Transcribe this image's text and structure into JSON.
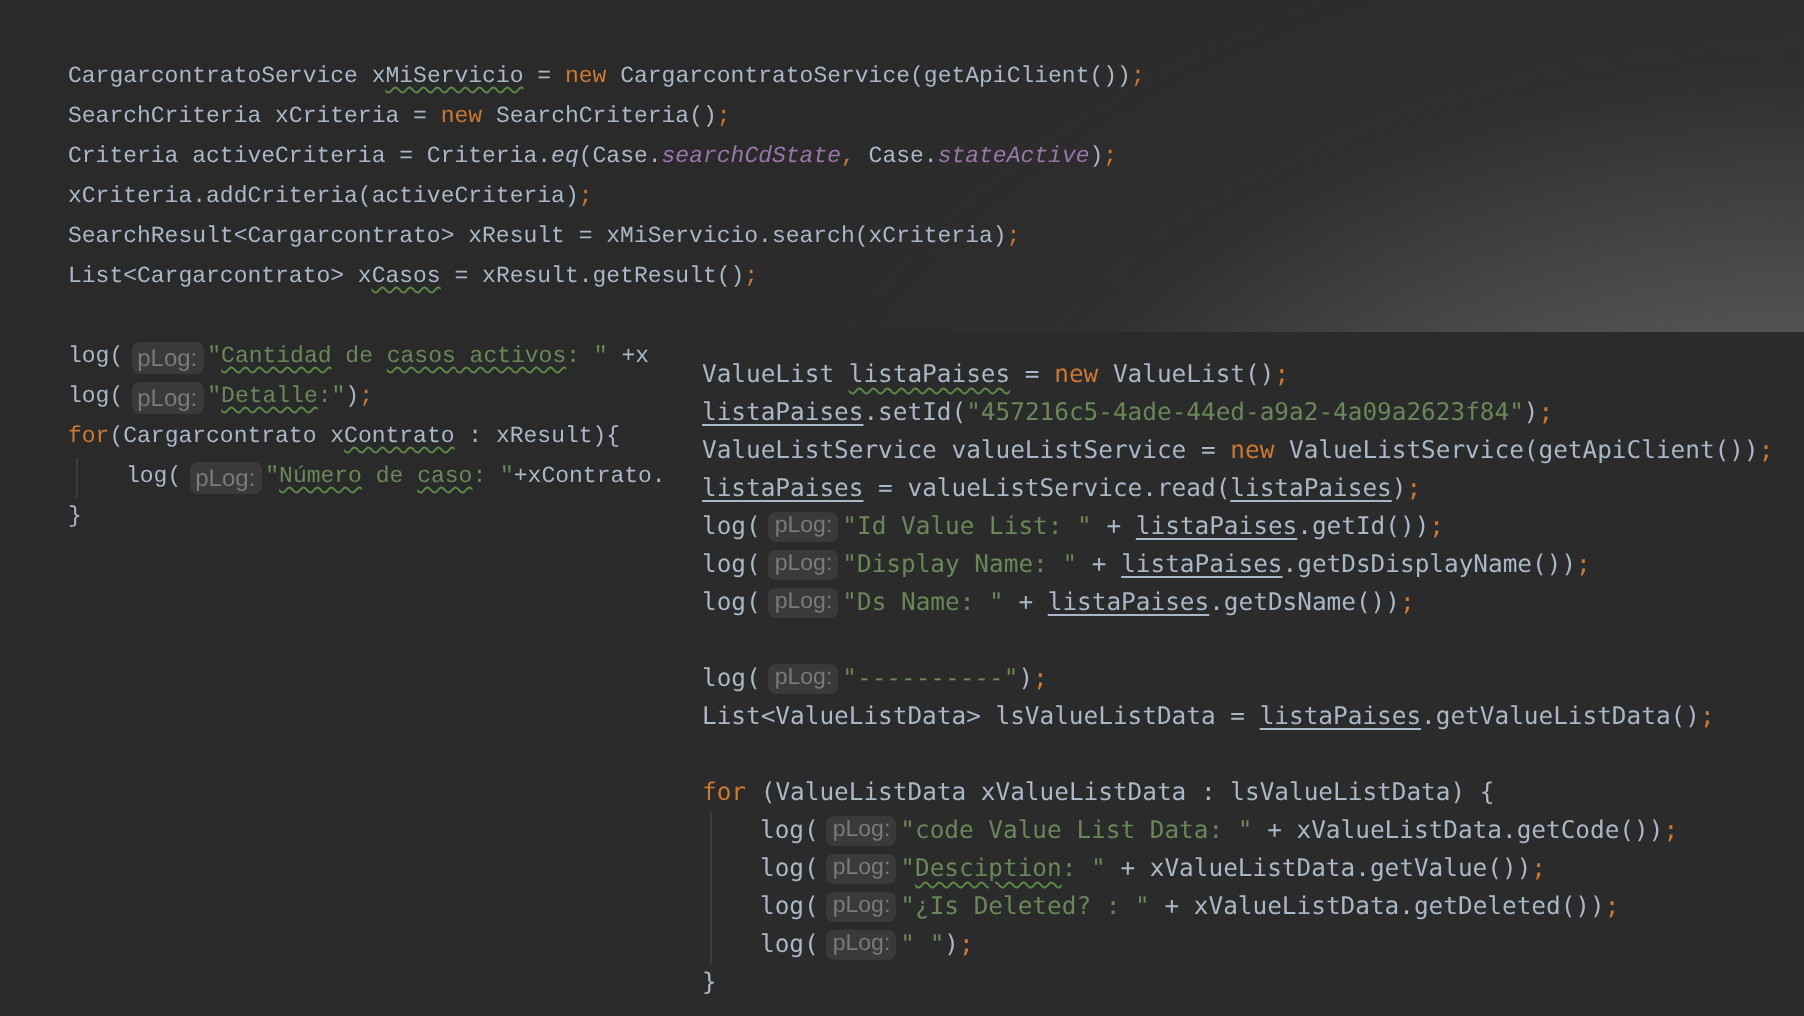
{
  "editors": [
    {
      "lines": [
        {
          "kind": "code",
          "tokens": [
            {
              "text": "CargarcontratoService x",
              "kind": "plain"
            },
            {
              "text": "MiServicio",
              "kind": "plain",
              "wavy": true
            },
            {
              "text": " = ",
              "kind": "plain"
            },
            {
              "text": "new",
              "kind": "keyword"
            },
            {
              "text": " CargarcontratoService(getApiClient())",
              "kind": "plain"
            },
            {
              "text": ";",
              "kind": "keyword"
            }
          ]
        },
        {
          "kind": "code",
          "tokens": [
            {
              "text": "SearchCriteria xCriteria = ",
              "kind": "plain"
            },
            {
              "text": "new",
              "kind": "keyword"
            },
            {
              "text": " SearchCriteria()",
              "kind": "plain"
            },
            {
              "text": ";",
              "kind": "keyword"
            }
          ]
        },
        {
          "kind": "code",
          "tokens": [
            {
              "text": "Criteria activeCriteria = Criteria.",
              "kind": "plain"
            },
            {
              "text": "eq",
              "kind": "method"
            },
            {
              "text": "(Case.",
              "kind": "plain"
            },
            {
              "text": "searchCdState",
              "kind": "field"
            },
            {
              "text": ",",
              "kind": "keyword"
            },
            {
              "text": " Case.",
              "kind": "plain"
            },
            {
              "text": "stateActive",
              "kind": "field"
            },
            {
              "text": ")",
              "kind": "plain"
            },
            {
              "text": ";",
              "kind": "keyword"
            }
          ]
        },
        {
          "kind": "code",
          "tokens": [
            {
              "text": "xCriteria.addCriteria(activeCriteria)",
              "kind": "plain"
            },
            {
              "text": ";",
              "kind": "keyword"
            }
          ]
        },
        {
          "kind": "code",
          "tokens": [
            {
              "text": "SearchResult<Cargarcontrato> xResult = xMiServicio.search(xCriteria)",
              "kind": "plain"
            },
            {
              "text": ";",
              "kind": "keyword"
            }
          ]
        },
        {
          "kind": "code",
          "tokens": [
            {
              "text": "List<Cargarcontrato> x",
              "kind": "plain"
            },
            {
              "text": "Casos",
              "kind": "plain",
              "wavy": true
            },
            {
              "text": " = xResult.getResult()",
              "kind": "plain"
            },
            {
              "text": ";",
              "kind": "keyword"
            }
          ]
        },
        {
          "kind": "blank"
        },
        {
          "kind": "code",
          "tokens": [
            {
              "text": "log(",
              "kind": "plain"
            },
            {
              "text": "pLog:",
              "kind": "hint"
            },
            {
              "text": "\"",
              "kind": "string"
            },
            {
              "text": "Cantidad",
              "kind": "string",
              "wavy": true
            },
            {
              "text": " de ",
              "kind": "string"
            },
            {
              "text": "casos",
              "kind": "string",
              "wavy": true
            },
            {
              "text": " activos",
              "kind": "string",
              "wavy": true
            },
            {
              "text": ": \"",
              "kind": "string"
            },
            {
              "text": " +x",
              "kind": "plain"
            }
          ]
        },
        {
          "kind": "code",
          "tokens": [
            {
              "text": "log(",
              "kind": "plain"
            },
            {
              "text": "pLog:",
              "kind": "hint"
            },
            {
              "text": "\"",
              "kind": "string"
            },
            {
              "text": "Detalle",
              "kind": "string",
              "wavy": true
            },
            {
              "text": ":\"",
              "kind": "string"
            },
            {
              "text": ")",
              "kind": "plain"
            },
            {
              "text": ";",
              "kind": "keyword"
            }
          ]
        },
        {
          "kind": "code",
          "tokens": [
            {
              "text": "for",
              "kind": "keyword"
            },
            {
              "text": "(Cargarcontrato x",
              "kind": "plain"
            },
            {
              "text": "Contrato",
              "kind": "plain",
              "wavy": true
            },
            {
              "text": " : xResult){",
              "kind": "plain"
            }
          ],
          "children": [
            {
              "kind": "code",
              "tokens": [
                {
                  "text": "log(",
                  "kind": "plain"
                },
                {
                  "text": "pLog:",
                  "kind": "hint"
                },
                {
                  "text": "\"",
                  "kind": "string"
                },
                {
                  "text": "Número",
                  "kind": "string",
                  "wavy": true
                },
                {
                  "text": " de ",
                  "kind": "string"
                },
                {
                  "text": "caso",
                  "kind": "string",
                  "wavy": true
                },
                {
                  "text": ": \"",
                  "kind": "string"
                },
                {
                  "text": "+xContrato.",
                  "kind": "plain"
                }
              ]
            }
          ]
        },
        {
          "kind": "code",
          "tokens": [
            {
              "text": "}",
              "kind": "plain"
            }
          ]
        }
      ]
    },
    {
      "lines": [
        {
          "kind": "code",
          "tokens": [
            {
              "text": "ValueList ",
              "kind": "plain"
            },
            {
              "text": "listaPaises",
              "kind": "plain",
              "wavy": true
            },
            {
              "text": " = ",
              "kind": "plain"
            },
            {
              "text": "new",
              "kind": "keyword"
            },
            {
              "text": " ValueList()",
              "kind": "plain"
            },
            {
              "text": ";",
              "kind": "keyword"
            }
          ]
        },
        {
          "kind": "code",
          "tokens": [
            {
              "text": "listaPaises",
              "kind": "plain",
              "underline": true
            },
            {
              "text": ".setId(",
              "kind": "plain"
            },
            {
              "text": "\"457216c5-4ade-44ed-a9a2-4a09a2623f84\"",
              "kind": "string"
            },
            {
              "text": ")",
              "kind": "plain"
            },
            {
              "text": ";",
              "kind": "keyword"
            }
          ]
        },
        {
          "kind": "code",
          "tokens": [
            {
              "text": "ValueListService valueListService = ",
              "kind": "plain"
            },
            {
              "text": "new",
              "kind": "keyword"
            },
            {
              "text": " ValueListService(getApiClient())",
              "kind": "plain"
            },
            {
              "text": ";",
              "kind": "keyword"
            }
          ]
        },
        {
          "kind": "code",
          "tokens": [
            {
              "text": "listaPaises",
              "kind": "plain",
              "underline": true
            },
            {
              "text": " = valueListService.read(",
              "kind": "plain"
            },
            {
              "text": "listaPaises",
              "kind": "plain",
              "underline": true
            },
            {
              "text": ")",
              "kind": "plain"
            },
            {
              "text": ";",
              "kind": "keyword"
            }
          ]
        },
        {
          "kind": "code",
          "tokens": [
            {
              "text": "log(",
              "kind": "plain"
            },
            {
              "text": "pLog:",
              "kind": "hint"
            },
            {
              "text": "\"Id Value List: \"",
              "kind": "string"
            },
            {
              "text": " + ",
              "kind": "plain"
            },
            {
              "text": "listaPaises",
              "kind": "plain",
              "underline": true
            },
            {
              "text": ".getId())",
              "kind": "plain"
            },
            {
              "text": ";",
              "kind": "keyword"
            }
          ]
        },
        {
          "kind": "code",
          "tokens": [
            {
              "text": "log(",
              "kind": "plain"
            },
            {
              "text": "pLog:",
              "kind": "hint"
            },
            {
              "text": "\"Display Name: \"",
              "kind": "string"
            },
            {
              "text": " + ",
              "kind": "plain"
            },
            {
              "text": "listaPaises",
              "kind": "plain",
              "underline": true
            },
            {
              "text": ".getDsDisplayName())",
              "kind": "plain"
            },
            {
              "text": ";",
              "kind": "keyword"
            }
          ]
        },
        {
          "kind": "code",
          "tokens": [
            {
              "text": "log(",
              "kind": "plain"
            },
            {
              "text": "pLog:",
              "kind": "hint"
            },
            {
              "text": "\"Ds Name: \"",
              "kind": "string"
            },
            {
              "text": " + ",
              "kind": "plain"
            },
            {
              "text": "listaPaises",
              "kind": "plain",
              "underline": true
            },
            {
              "text": ".getDsName())",
              "kind": "plain"
            },
            {
              "text": ";",
              "kind": "keyword"
            }
          ]
        },
        {
          "kind": "blank"
        },
        {
          "kind": "code",
          "tokens": [
            {
              "text": "log(",
              "kind": "plain"
            },
            {
              "text": "pLog:",
              "kind": "hint"
            },
            {
              "text": "\"----------\"",
              "kind": "string"
            },
            {
              "text": ")",
              "kind": "plain"
            },
            {
              "text": ";",
              "kind": "keyword"
            }
          ]
        },
        {
          "kind": "code",
          "tokens": [
            {
              "text": "List<ValueListData> lsValueListData = ",
              "kind": "plain"
            },
            {
              "text": "listaPaises",
              "kind": "plain",
              "underline": true
            },
            {
              "text": ".getValueListData()",
              "kind": "plain"
            },
            {
              "text": ";",
              "kind": "keyword"
            }
          ]
        },
        {
          "kind": "blank"
        },
        {
          "kind": "code",
          "tokens": [
            {
              "text": "for",
              "kind": "keyword"
            },
            {
              "text": " (ValueListData xValueListData : lsValueListData) {",
              "kind": "plain"
            }
          ],
          "children": [
            {
              "kind": "code",
              "tokens": [
                {
                  "text": "log(",
                  "kind": "plain"
                },
                {
                  "text": "pLog:",
                  "kind": "hint"
                },
                {
                  "text": "\"code Value List Data: \"",
                  "kind": "string"
                },
                {
                  "text": " + xValueListData.getCode())",
                  "kind": "plain"
                },
                {
                  "text": ";",
                  "kind": "keyword"
                }
              ]
            },
            {
              "kind": "code",
              "tokens": [
                {
                  "text": "log(",
                  "kind": "plain"
                },
                {
                  "text": "pLog:",
                  "kind": "hint"
                },
                {
                  "text": "\"",
                  "kind": "string"
                },
                {
                  "text": "Desciption",
                  "kind": "string",
                  "wavy": true
                },
                {
                  "text": ": \"",
                  "kind": "string"
                },
                {
                  "text": " + xValueListData.getValue())",
                  "kind": "plain"
                },
                {
                  "text": ";",
                  "kind": "keyword"
                }
              ]
            },
            {
              "kind": "code",
              "tokens": [
                {
                  "text": "log(",
                  "kind": "plain"
                },
                {
                  "text": "pLog:",
                  "kind": "hint"
                },
                {
                  "text": "\"¿Is Deleted? : \"",
                  "kind": "string"
                },
                {
                  "text": " + xValueListData.getDeleted())",
                  "kind": "plain"
                },
                {
                  "text": ";",
                  "kind": "keyword"
                }
              ]
            },
            {
              "kind": "code",
              "tokens": [
                {
                  "text": "log(",
                  "kind": "plain"
                },
                {
                  "text": "pLog:",
                  "kind": "hint"
                },
                {
                  "text": "\" \"",
                  "kind": "string"
                },
                {
                  "text": ")",
                  "kind": "plain"
                },
                {
                  "text": ";",
                  "kind": "keyword"
                }
              ]
            }
          ]
        },
        {
          "kind": "code",
          "tokens": [
            {
              "text": "}",
              "kind": "plain"
            }
          ]
        }
      ]
    }
  ]
}
